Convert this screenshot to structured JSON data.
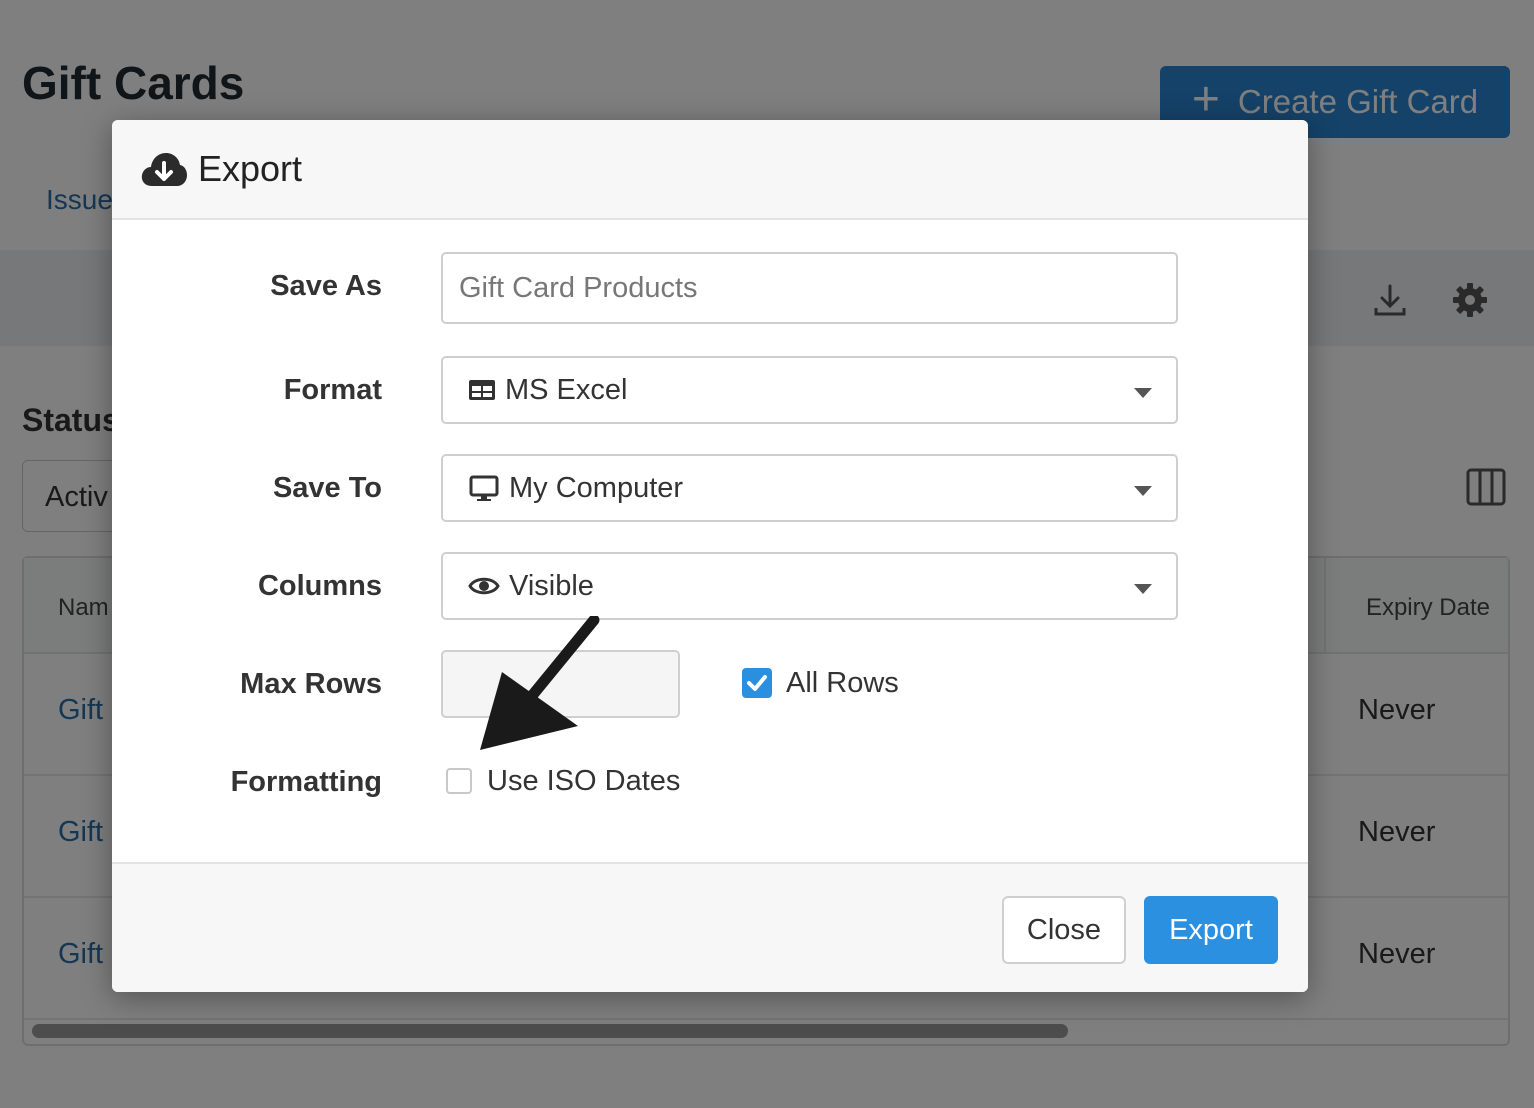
{
  "page": {
    "title": "Gift Cards",
    "create_button_label": "Create Gift Card",
    "tab_label": "Issue",
    "status_label": "Status",
    "status_value": "Activ",
    "table": {
      "headers": {
        "name": "Nam",
        "expiry": "Expiry Date"
      },
      "rows": [
        {
          "name": "Gift",
          "expiry": "Never"
        },
        {
          "name": "Gift",
          "expiry": "Never"
        },
        {
          "name": "Gift",
          "expiry": "Never"
        }
      ]
    }
  },
  "modal": {
    "title": "Export",
    "title_icon": "cloud-download-icon",
    "fields": {
      "save_as": {
        "label": "Save As",
        "placeholder": "Gift Card Products"
      },
      "format": {
        "label": "Format",
        "value": "MS Excel",
        "icon": "table-icon"
      },
      "save_to": {
        "label": "Save To",
        "value": "My Computer",
        "icon": "desktop-icon"
      },
      "columns": {
        "label": "Columns",
        "value": "Visible",
        "icon": "eye-icon"
      },
      "max_rows": {
        "label": "Max Rows",
        "value": ""
      },
      "all_rows": {
        "label": "All Rows",
        "checked": true
      },
      "formatting": {
        "label": "Formatting"
      },
      "iso_dates": {
        "label": "Use ISO Dates",
        "checked": false
      }
    },
    "footer": {
      "close_label": "Close",
      "export_label": "Export"
    }
  },
  "colors": {
    "primary": "#2b90e0",
    "link": "#2a6fa8",
    "overlay": "rgba(0,0,0,0.5)"
  }
}
